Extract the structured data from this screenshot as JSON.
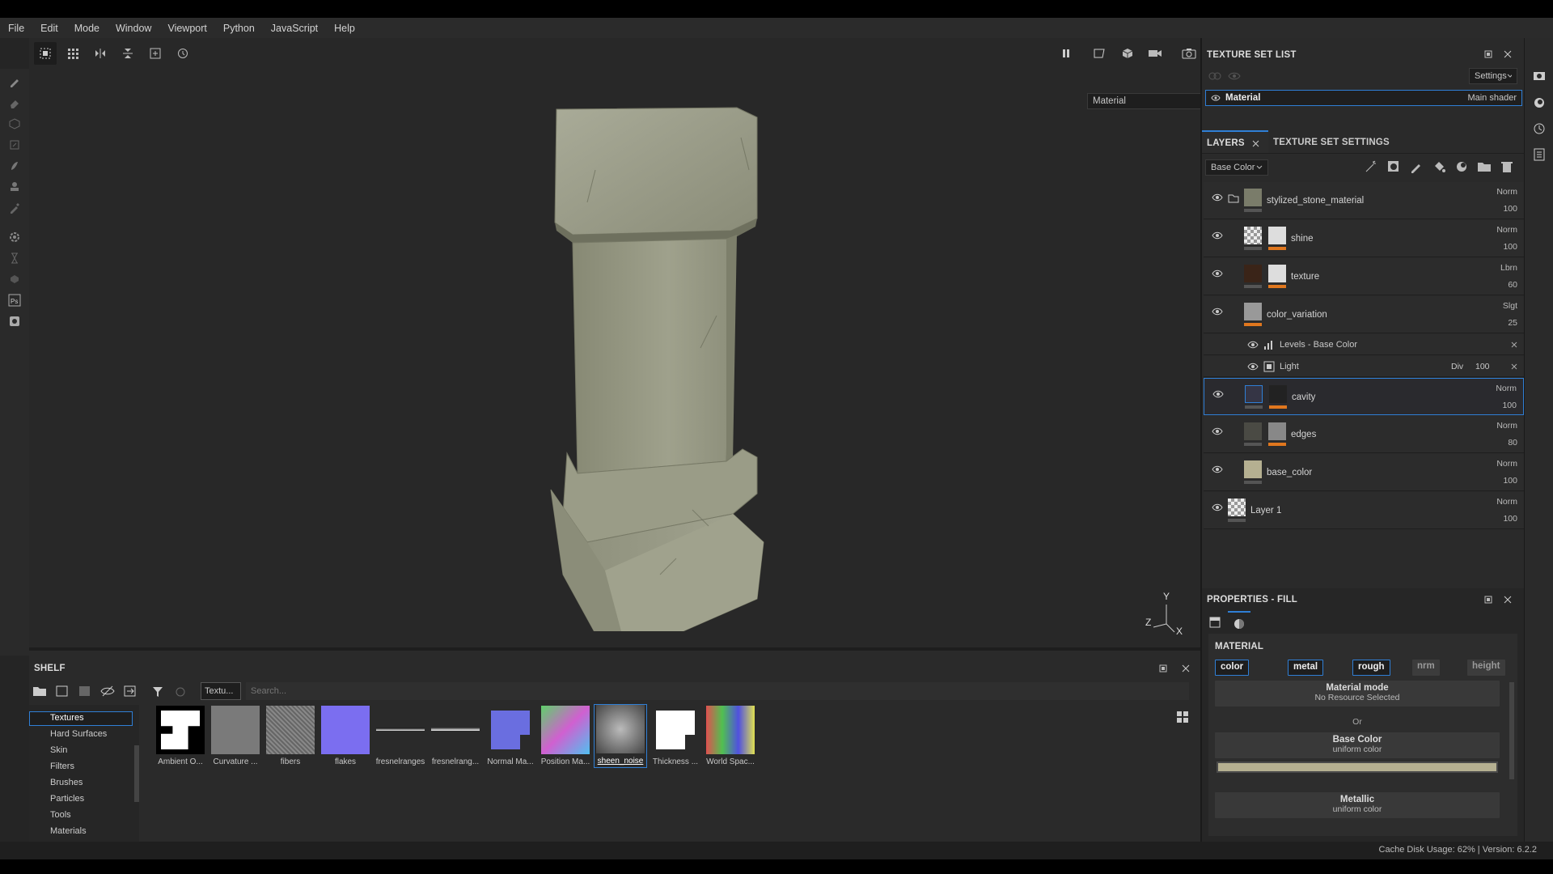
{
  "menu": [
    "File",
    "Edit",
    "Mode",
    "Window",
    "Viewport",
    "Python",
    "JavaScript",
    "Help"
  ],
  "viewport": {
    "dropdown": "Material",
    "gizmo": {
      "y": "Y",
      "z": "Z",
      "x": "X"
    }
  },
  "texture_set_list": {
    "title": "TEXTURE SET LIST",
    "settings_label": "Settings",
    "material_name": "Material",
    "shader": "Main shader"
  },
  "layers_panel": {
    "tab_layers": "LAYERS",
    "tab_tss": "TEXTURE SET SETTINGS",
    "channel": "Base Color",
    "layers": [
      {
        "name": "stylized_stone_material",
        "blend": "Norm",
        "opacity": "100",
        "type": "folder"
      },
      {
        "name": "shine",
        "blend": "Norm",
        "opacity": "100",
        "type": "fill"
      },
      {
        "name": "texture",
        "blend": "Lbrn",
        "opacity": "60",
        "type": "fill"
      },
      {
        "name": "color_variation",
        "blend": "Slgt",
        "opacity": "25",
        "type": "fill"
      },
      {
        "name": "cavity",
        "blend": "Norm",
        "opacity": "100",
        "type": "fill",
        "selected": true
      },
      {
        "name": "edges",
        "blend": "Norm",
        "opacity": "80",
        "type": "fill"
      },
      {
        "name": "base_color",
        "blend": "Norm",
        "opacity": "100",
        "type": "fill"
      },
      {
        "name": "Layer 1",
        "blend": "Norm",
        "opacity": "100",
        "type": "paint"
      }
    ],
    "effects": [
      {
        "name": "Levels - Base Color"
      },
      {
        "name": "Light",
        "blend": "Div",
        "opacity": "100"
      }
    ]
  },
  "properties": {
    "title": "PROPERTIES - FILL",
    "section": "MATERIAL",
    "chips": [
      "color",
      "metal",
      "rough",
      "nrm",
      "height"
    ],
    "material_mode": "Material mode",
    "no_resource": "No Resource Selected",
    "or": "Or",
    "base_color": "Base Color",
    "base_color_sub": "uniform color",
    "metallic": "Metallic",
    "metallic_sub": "uniform color"
  },
  "shelf": {
    "title": "SHELF",
    "filter_tag": "Textu...",
    "search_placeholder": "Search...",
    "categories": [
      "Textures",
      "Hard Surfaces",
      "Skin",
      "Filters",
      "Brushes",
      "Particles",
      "Tools",
      "Materials"
    ],
    "items": [
      "Ambient O...",
      "Curvature ...",
      "fibers",
      "flakes",
      "fresnelranges",
      "fresnelrang...",
      "Normal Ma...",
      "Position Ma...",
      "sheen_noise",
      "Thickness ...",
      "World Spac..."
    ]
  },
  "status": {
    "text": "Cache Disk Usage:   62% | Version: 6.2.2"
  },
  "colors": {
    "accent": "#2f7fd6",
    "orange": "#e0771e",
    "bg": "#252525"
  }
}
